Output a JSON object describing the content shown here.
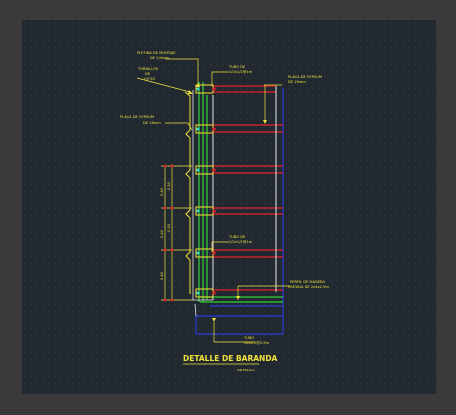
{
  "colors": {
    "background": "#3a3a3a",
    "canvas": "#212830",
    "annotation": "#f2e33c",
    "railing_red": "#e8222e",
    "panel_blue": "#2b3cd9",
    "glass_green": "#33d13a",
    "wall_white": "#e8e8e8",
    "cyan": "#35d6d6"
  },
  "annotations": {
    "platina_line1": "PLETINA DE MONTAJE",
    "platina_line2": "DE 1/4mm",
    "tornillos_line1": "TORNILLOS",
    "tornillos_line2": "DE",
    "tornillos_line3": "1/4\"X2",
    "tubo_top_line1": "TUBO DE",
    "tubo_top_line2": "1/2x1/2@1m",
    "placa_right_line1": "PLACA DE GYPSUM",
    "placa_right_line2": "DE 16mm",
    "placa_left_line1": "PLACA DE GYPSUM",
    "placa_left_line2": "DE 16mm",
    "tubo_mid_line1": "TUBO DE",
    "tubo_mid_line2": "1/2x1/2@1m",
    "viga_line1": "PERFIL DE MADERA",
    "viga_line2": "PINTADA DE 2x4x2.5m",
    "tubo_bottom_line1": "TUBO",
    "tubo_bottom_line2": "2x4x.2@2.5m"
  },
  "dimensions": [
    "0.50",
    "0.40",
    "0.50",
    "0.40",
    "0.40"
  ],
  "title": "DETALLE DE BARANDA",
  "scale_label": "SIN ESCALA"
}
